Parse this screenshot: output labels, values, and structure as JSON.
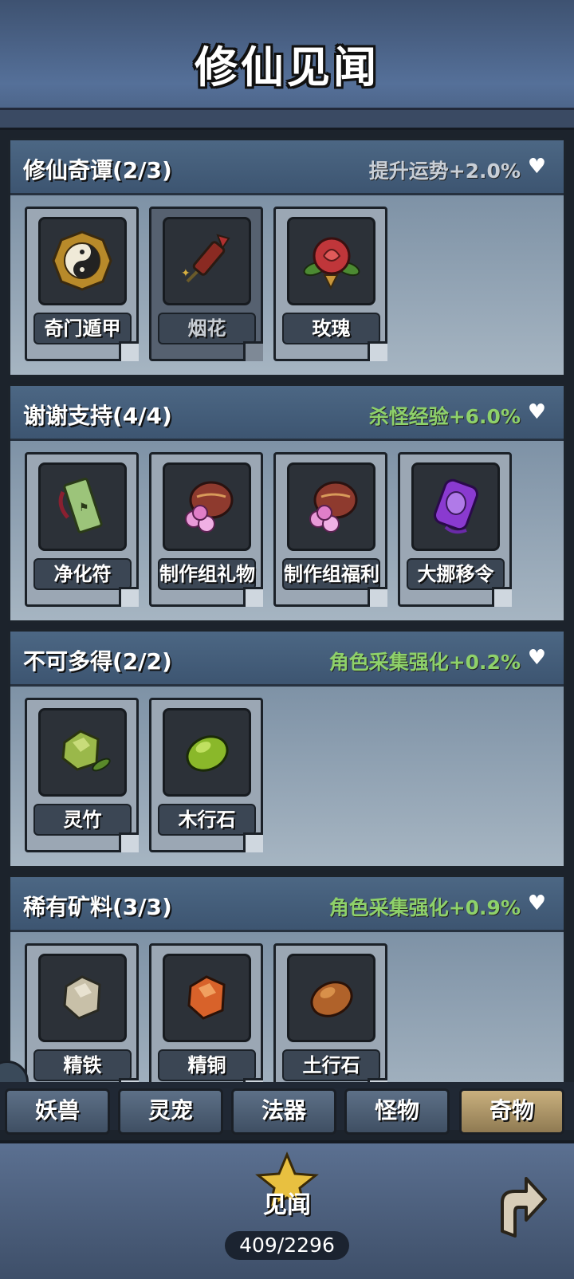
{
  "title": "修仙见闻",
  "sections": [
    {
      "name": "修仙奇谭(2/3)",
      "bonus": "提升运势+2.0%",
      "bonus_color": "#c9cfd6",
      "items": [
        {
          "label": "奇门遁甲",
          "icon": "taiji-medallion-icon"
        },
        {
          "label": "烟花",
          "icon": "firework-rocket-icon",
          "locked": true
        },
        {
          "label": "玫瑰",
          "icon": "rose-icon"
        }
      ]
    },
    {
      "name": "谢谢支持(4/4)",
      "bonus": "杀怪经验+6.0%",
      "bonus_color": "#8ed16a",
      "items": [
        {
          "label": "净化符",
          "icon": "talisman-scroll-icon"
        },
        {
          "label": "制作组礼物",
          "icon": "gift-pouch-icon"
        },
        {
          "label": "制作组福利",
          "icon": "gift-pouch-icon"
        },
        {
          "label": "大挪移令",
          "icon": "purple-token-icon"
        }
      ]
    },
    {
      "name": "不可多得(2/2)",
      "bonus": "角色采集强化+0.2%",
      "bonus_color": "#8ed16a",
      "items": [
        {
          "label": "灵竹",
          "icon": "green-ore-leaf-icon"
        },
        {
          "label": "木行石",
          "icon": "green-stone-icon"
        }
      ]
    },
    {
      "name": "稀有矿料(3/3)",
      "bonus": "角色采集强化+0.9%",
      "bonus_color": "#8ed16a",
      "items": [
        {
          "label": "精铁",
          "icon": "grey-ore-icon"
        },
        {
          "label": "精铜",
          "icon": "copper-ore-icon"
        },
        {
          "label": "土行石",
          "icon": "brown-stone-icon"
        }
      ]
    }
  ],
  "heart_symbol": "♥",
  "tabs": [
    {
      "label": "妖兽"
    },
    {
      "label": "灵宠"
    },
    {
      "label": "法器"
    },
    {
      "label": "怪物"
    },
    {
      "label": "奇物",
      "active": true
    }
  ],
  "footer": {
    "star_label": "见闻",
    "progress": "409/2296"
  }
}
